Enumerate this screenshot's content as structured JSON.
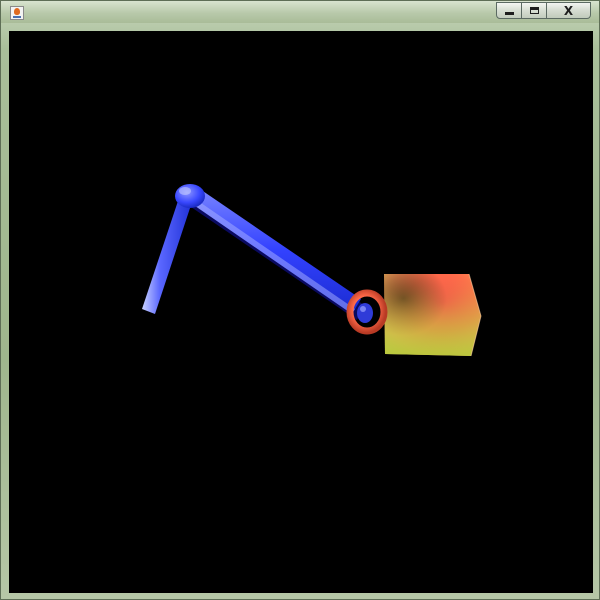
{
  "window": {
    "title": ""
  },
  "controls": {
    "minimize_icon": "minimize-icon",
    "maximize_icon": "maximize-icon",
    "close_icon": "close-icon",
    "close_glyph": "X"
  },
  "scene": {
    "background_color": "#000000",
    "arm_color": "#3a48f2",
    "ring_color": "#ff6a4a",
    "cube_colors": [
      "#ff3a3a",
      "#ffd06a",
      "#9acd32"
    ]
  }
}
